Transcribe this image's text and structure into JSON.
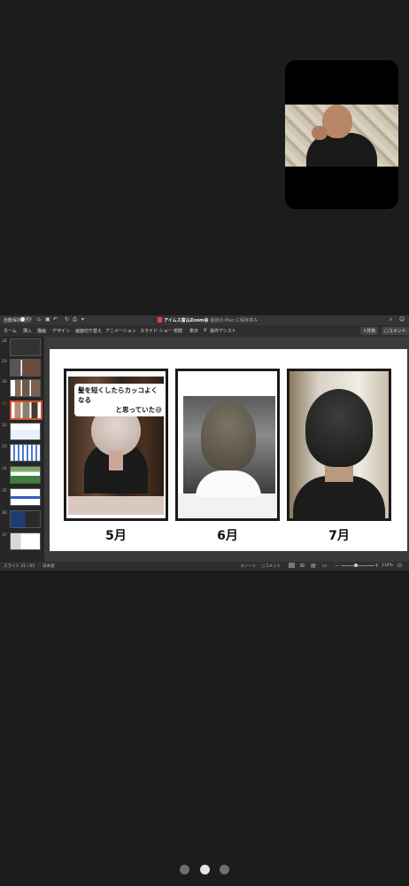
{
  "window": {
    "autosave_label": "自動保存",
    "autosave_state": "オフ",
    "doc_title": "アイムス富山Zoom会",
    "save_status": "— 最後の Mac に保存済み"
  },
  "ribbon": {
    "tabs": [
      "ホーム",
      "挿入",
      "描画",
      "デザイン",
      "画面切り替え",
      "アニメーション",
      "スライド ショー",
      "校閲",
      "表示"
    ],
    "assist": "操作アシスト",
    "share_label": "共有",
    "comment_label": "コメント"
  },
  "thumbnails": [
    {
      "num": "28"
    },
    {
      "num": "29"
    },
    {
      "num": "30"
    },
    {
      "num": "31"
    },
    {
      "num": "32"
    },
    {
      "num": "33"
    },
    {
      "num": "34"
    },
    {
      "num": "35"
    },
    {
      "num": "36"
    },
    {
      "num": "37"
    }
  ],
  "slide": {
    "caption_line1": "髪を短くしたらカッコよくなる",
    "caption_line2": "と思っていた😅",
    "months": [
      "5月",
      "6月",
      "7月"
    ]
  },
  "status": {
    "slide_position": "スライド 31 / 65",
    "language": "日本語",
    "notes": "ノート",
    "comments": "コメント",
    "zoom": "118%"
  },
  "pager": {
    "count": 3,
    "active": 1
  }
}
